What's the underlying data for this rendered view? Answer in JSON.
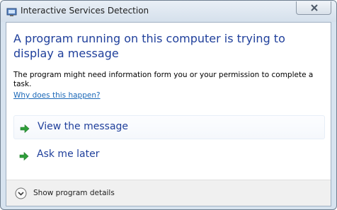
{
  "window": {
    "title": "Interactive Services Detection"
  },
  "dialog": {
    "heading": "A program running on this computer is trying to display a message",
    "description": "The program might need information form you or your permission to complete a task.",
    "why_link": "Why does this happen?",
    "options": [
      {
        "label": "View the message",
        "icon": "green-arrow-icon"
      },
      {
        "label": "Ask me later",
        "icon": "green-arrow-icon"
      }
    ],
    "footer_label": "Show program details"
  },
  "colors": {
    "heading": "#1f3f9b",
    "link": "#1b68b8",
    "arrow": "#2e9e3a",
    "frame": "#d7e3ef"
  }
}
